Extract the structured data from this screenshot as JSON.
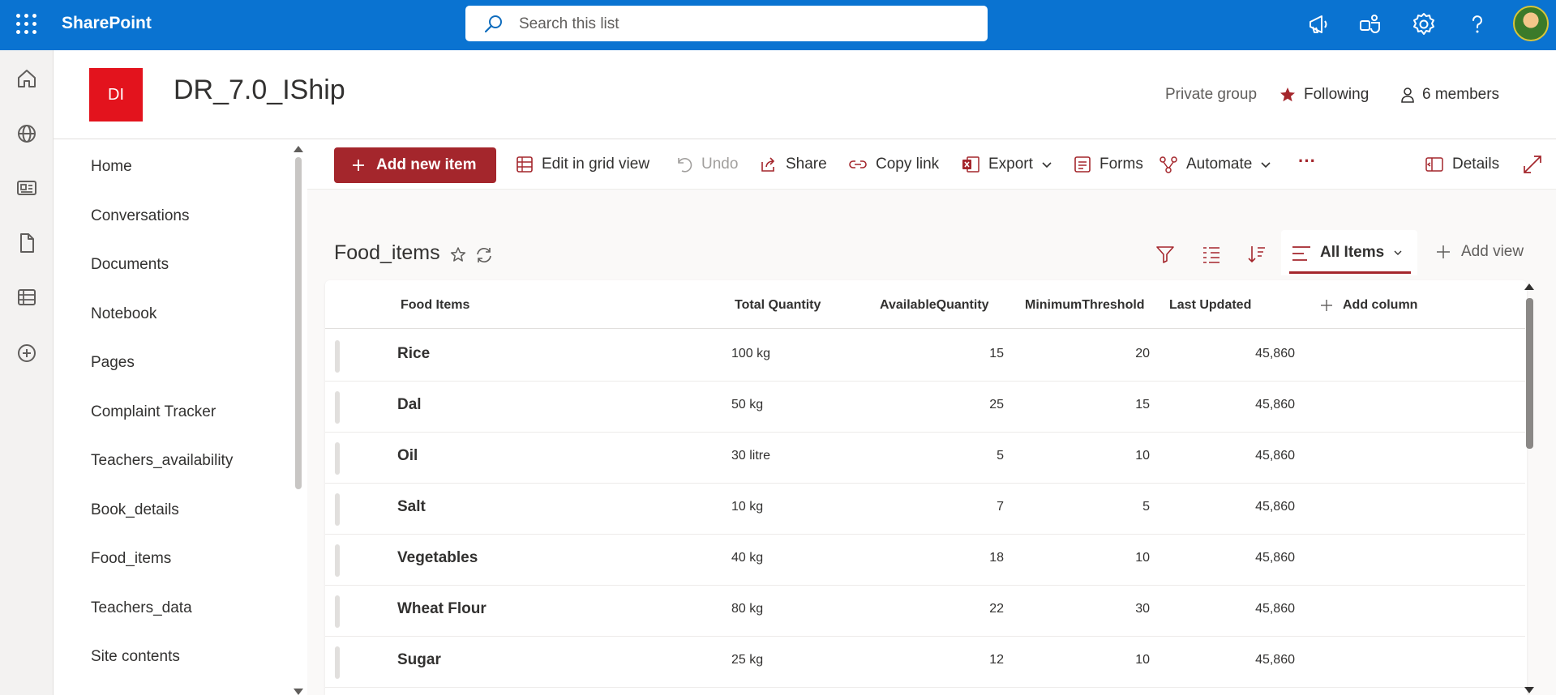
{
  "suite": {
    "brand": "SharePoint",
    "search_placeholder": "Search this list"
  },
  "site": {
    "logo_text": "DI",
    "title": "DR_7.0_IShip",
    "privacy": "Private group",
    "following": "Following",
    "members": "6 members"
  },
  "nav": {
    "items": [
      "Home",
      "Conversations",
      "Documents",
      "Notebook",
      "Pages",
      "Complaint Tracker",
      "Teachers_availability",
      "Book_details",
      "Food_items",
      "Teachers_data",
      "Site contents"
    ]
  },
  "commands": {
    "add_new_item": "Add new item",
    "edit_grid": "Edit in grid view",
    "undo": "Undo",
    "share": "Share",
    "copy_link": "Copy link",
    "export": "Export",
    "forms": "Forms",
    "automate": "Automate",
    "more": "···",
    "details": "Details"
  },
  "list": {
    "title": "Food_items",
    "current_view": "All Items",
    "add_view": "Add view",
    "columns": {
      "food_items": "Food Items",
      "total_quantity": "Total Quantity",
      "available_quantity": "AvailableQuantity",
      "minimum_threshold": "MinimumThreshold",
      "last_updated": "Last Updated",
      "add_column": "Add column"
    },
    "rows": [
      {
        "name": "Rice",
        "total": "100 kg",
        "available": "15",
        "minimum": "20",
        "updated": "45,860"
      },
      {
        "name": "Dal",
        "total": "50 kg",
        "available": "25",
        "minimum": "15",
        "updated": "45,860"
      },
      {
        "name": "Oil",
        "total": "30 litre",
        "available": "5",
        "minimum": "10",
        "updated": "45,860"
      },
      {
        "name": "Salt",
        "total": "10 kg",
        "available": "7",
        "minimum": "5",
        "updated": "45,860"
      },
      {
        "name": "Vegetables",
        "total": "40 kg",
        "available": "18",
        "minimum": "10",
        "updated": "45,860"
      },
      {
        "name": "Wheat Flour",
        "total": "80 kg",
        "available": "22",
        "minimum": "30",
        "updated": "45,860"
      },
      {
        "name": "Sugar",
        "total": "25 kg",
        "available": "12",
        "minimum": "10",
        "updated": "45,860"
      }
    ]
  },
  "colors": {
    "suite_bar": "#0a73d1",
    "accent": "#a4262c",
    "site_logo": "#e3131d"
  },
  "icons": {
    "waffle": "app-launcher-icon",
    "search": "search-icon",
    "megaphone": "news-icon",
    "teams": "teams-icon",
    "settings": "gear-icon",
    "help": "help-icon"
  }
}
